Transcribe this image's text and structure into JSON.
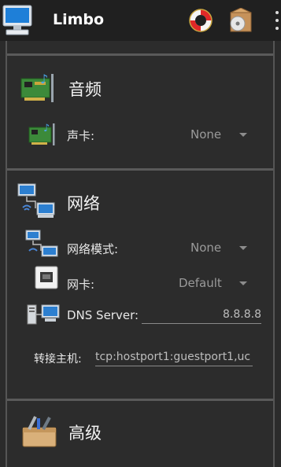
{
  "app": {
    "title": "Limbo"
  },
  "sections": {
    "audio": {
      "title": "音频",
      "sound_card": {
        "label": "声卡:",
        "value": "None"
      }
    },
    "network": {
      "title": "网络",
      "mode": {
        "label": "网络模式:",
        "value": "None"
      },
      "nic": {
        "label": "网卡:",
        "value": "Default"
      },
      "dns": {
        "label": "DNS Server:",
        "value": "8.8.8.8"
      },
      "forward": {
        "label": "转接主机:",
        "value": "tcp:hostport1:guestport1,uc"
      }
    },
    "advanced": {
      "title": "高级"
    }
  },
  "colors": {
    "appbar": "#202020",
    "background": "#2b2b2b",
    "divider": "#5a5a5a",
    "muted_value": "#9a9a9a"
  },
  "icons": [
    "computer-icon",
    "lifebuoy-icon",
    "disc-box-icon",
    "overflow-menu-icon",
    "sound-card-icon",
    "network-computers-icon",
    "network-card-icon",
    "dns-server-icon",
    "tools-box-icon"
  ]
}
